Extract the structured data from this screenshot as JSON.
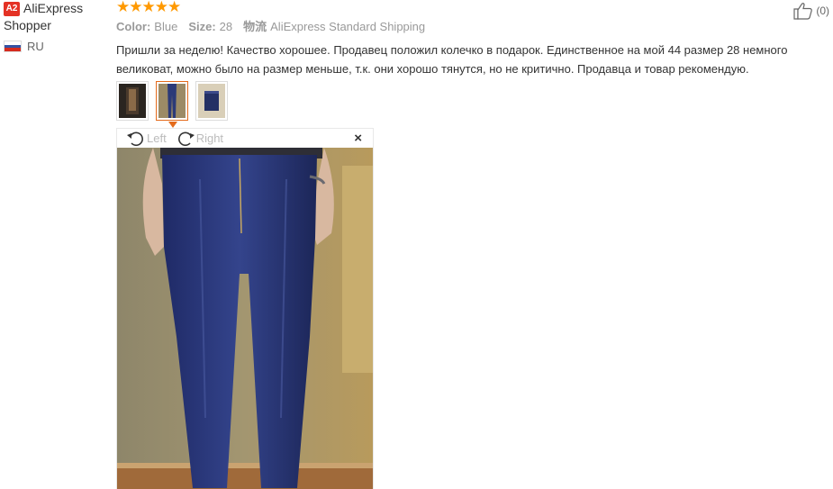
{
  "user": {
    "badge": "A2",
    "name_line1": "AliExpress",
    "name_line2": "Shopper",
    "country": "RU"
  },
  "review": {
    "stars": "★★★★★",
    "color_label": "Color:",
    "color_value": "Blue",
    "size_label": "Size:",
    "size_value": "28",
    "shipping_label": "物流",
    "shipping_value": "AliExpress Standard Shipping",
    "comment": "Пришли за неделю! Качество хорошее. Продавец положил колечко в подарок. Единственное на мой 44 размер 28 немного великоват, можно было на размер меньше, т.к. они хорошо тянутся, но не критично. Продавца и товар рекомендую."
  },
  "like": {
    "count": "(0)"
  },
  "viewer": {
    "rotate_left": "Left",
    "rotate_right": "Right",
    "close": "×"
  },
  "colors": {
    "star": "#ff9900",
    "accent": "#e46b1c",
    "badge": "#e43225"
  }
}
